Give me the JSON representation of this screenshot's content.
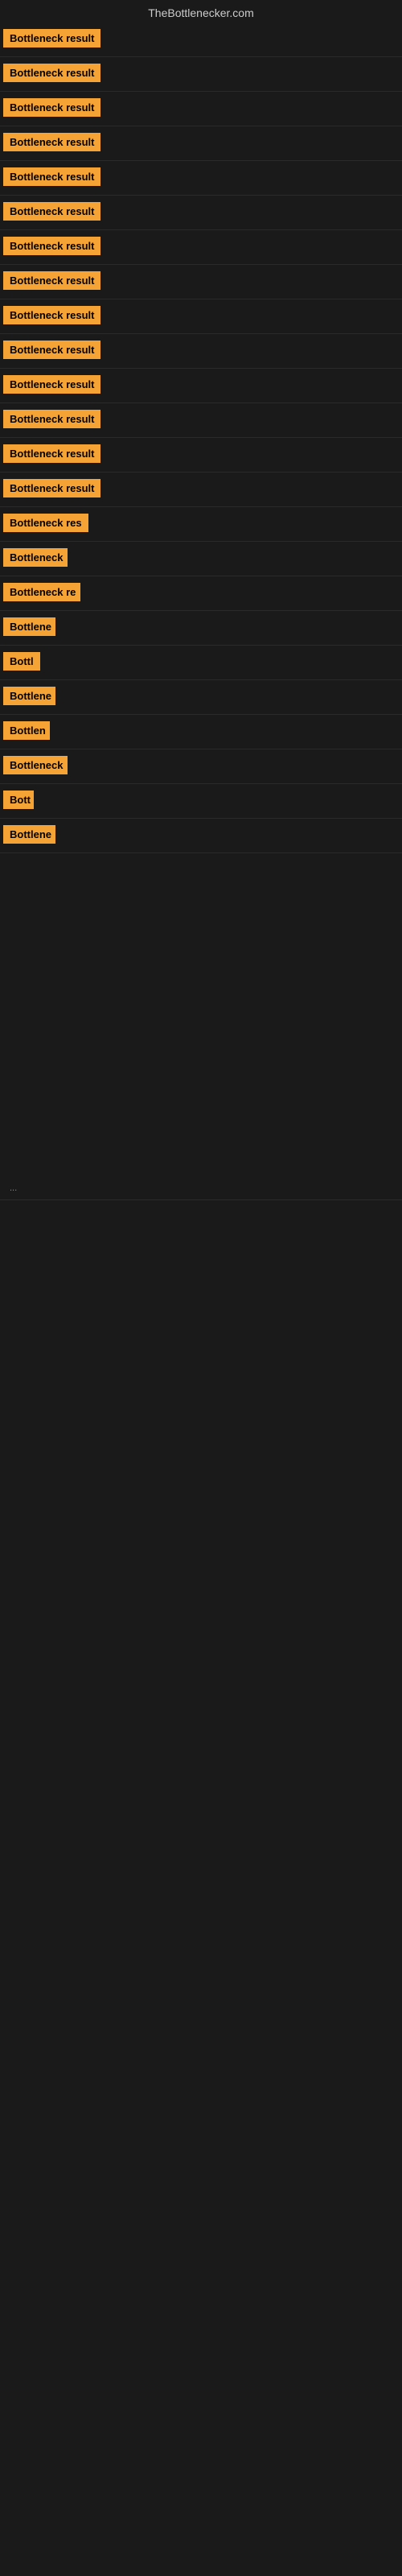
{
  "header": {
    "title": "TheBottlenecker.com"
  },
  "rows": [
    {
      "label": "Bottleneck result",
      "width": 130
    },
    {
      "label": "Bottleneck result",
      "width": 130
    },
    {
      "label": "Bottleneck result",
      "width": 130
    },
    {
      "label": "Bottleneck result",
      "width": 130
    },
    {
      "label": "Bottleneck result",
      "width": 130
    },
    {
      "label": "Bottleneck result",
      "width": 130
    },
    {
      "label": "Bottleneck result",
      "width": 130
    },
    {
      "label": "Bottleneck result",
      "width": 130
    },
    {
      "label": "Bottleneck result",
      "width": 130
    },
    {
      "label": "Bottleneck result",
      "width": 130
    },
    {
      "label": "Bottleneck result",
      "width": 130
    },
    {
      "label": "Bottleneck result",
      "width": 130
    },
    {
      "label": "Bottleneck result",
      "width": 130
    },
    {
      "label": "Bottleneck result",
      "width": 130
    },
    {
      "label": "Bottleneck res",
      "width": 110
    },
    {
      "label": "Bottleneck",
      "width": 80
    },
    {
      "label": "Bottleneck re",
      "width": 96
    },
    {
      "label": "Bottlene",
      "width": 65
    },
    {
      "label": "Bottl",
      "width": 48
    },
    {
      "label": "Bottlene",
      "width": 65
    },
    {
      "label": "Bottlen",
      "width": 58
    },
    {
      "label": "Bottleneck",
      "width": 80
    },
    {
      "label": "Bott",
      "width": 38
    },
    {
      "label": "Bottlene",
      "width": 65
    }
  ],
  "ellipsis": "..."
}
